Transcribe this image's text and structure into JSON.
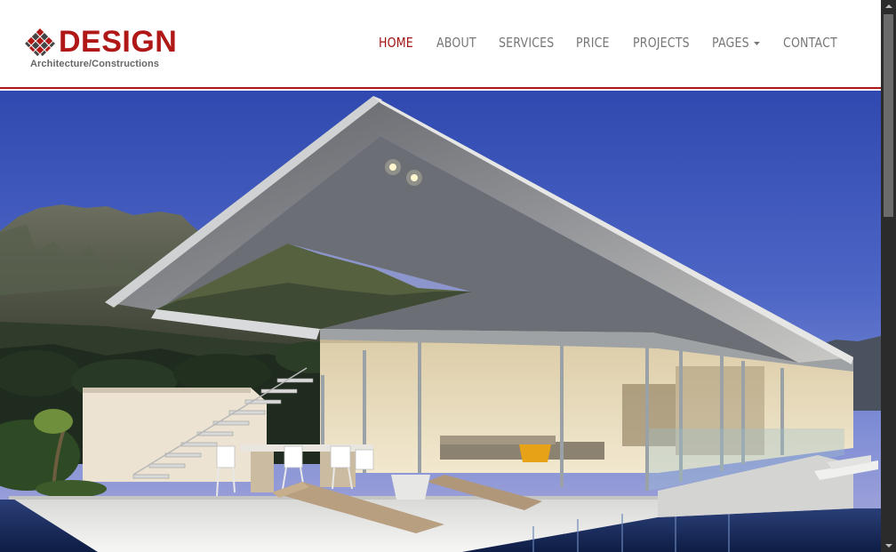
{
  "brand": {
    "name": "DESIGN",
    "tagline": "Architecture/Constructions",
    "accent_color": "#b01717"
  },
  "nav": {
    "items": [
      {
        "label": "HOME",
        "active": true
      },
      {
        "label": "ABOUT",
        "active": false
      },
      {
        "label": "SERVICES",
        "active": false
      },
      {
        "label": "PRICE",
        "active": false
      },
      {
        "label": "PROJECTS",
        "active": false
      },
      {
        "label": "PAGES",
        "active": false,
        "dropdown": true
      },
      {
        "label": "CONTACT",
        "active": false
      }
    ]
  },
  "hero": {
    "image": "modern-glass-villa-with-mountains"
  },
  "scrollbar": {
    "up_icon": "arrow-up-icon",
    "down_icon": "arrow-down-icon"
  }
}
